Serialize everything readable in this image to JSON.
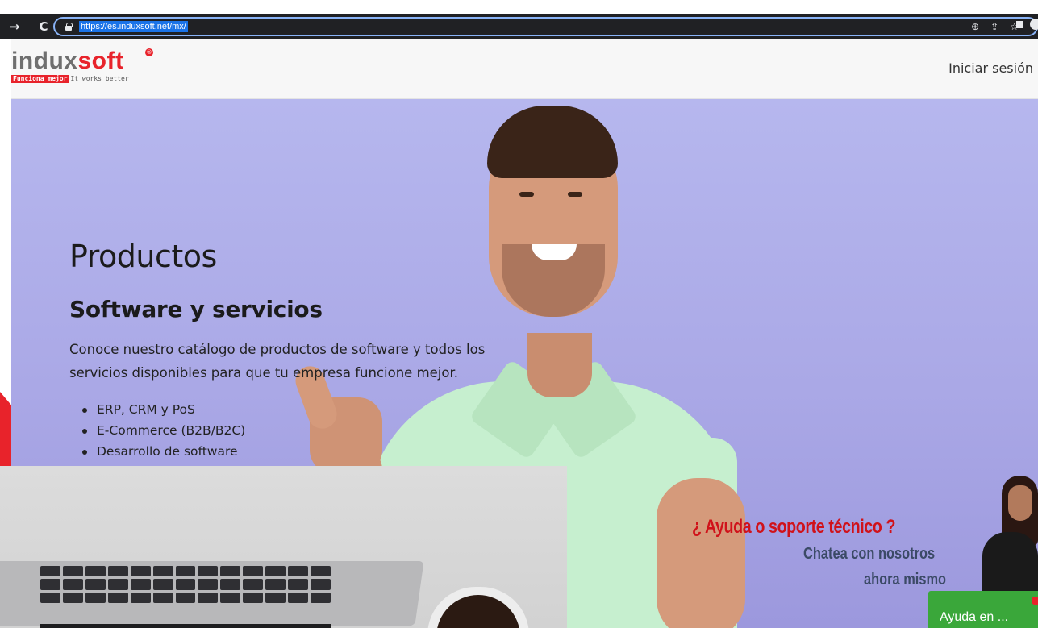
{
  "browser": {
    "back_icon": "arrow-right-icon",
    "reload_icon": "reload-icon",
    "url": "https://es.induxsoft.net/mx/",
    "icons": [
      "zoom-icon",
      "share-icon",
      "bookmark-star-icon",
      "extension-square-icon",
      "profile-avatar-icon"
    ]
  },
  "header": {
    "logo": {
      "part1": "indux",
      "part2": "soft",
      "registered": "®",
      "tagline_highlight": "Funciona mejor",
      "tagline_rest": "It works better"
    },
    "login_label": "Iniciar sesión"
  },
  "hero": {
    "title": "Productos",
    "subtitle": "Software y servicios",
    "description": "Conoce nuestro catálogo de productos de software y todos los servicios disponibles para que tu empresa funcione mejor.",
    "list": [
      "ERP, CRM y PoS",
      "E-Commerce (B2B/B2C)",
      "Desarrollo de software"
    ]
  },
  "support_widget": {
    "title": "¿ Ayuda o soporte técnico ?",
    "line1": "Chatea con nosotros",
    "line2": "ahora mismo",
    "button_label": "Ayuda en ..."
  },
  "colors": {
    "brand_red": "#e8232b",
    "hero_bg": "#b0b0ea",
    "chat_green": "#3aa73a"
  }
}
